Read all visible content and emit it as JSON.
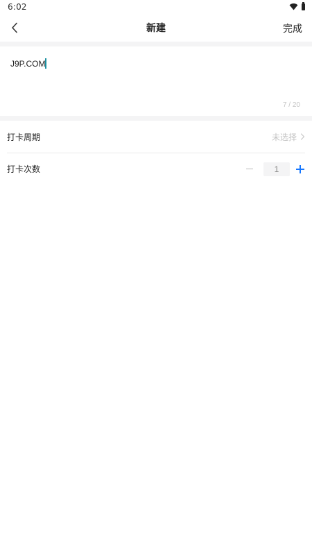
{
  "status_bar": {
    "time": "6:02"
  },
  "header": {
    "title": "新建",
    "done_label": "完成"
  },
  "editor": {
    "value": "J9P.COM",
    "counter": "7 / 20"
  },
  "settings": {
    "period": {
      "label": "打卡周期",
      "value": "未选择"
    },
    "count": {
      "label": "打卡次数",
      "value": "1"
    }
  },
  "colors": {
    "accent": "#1677ff",
    "caret": "#1a8fa0",
    "divider_bg": "#f4f4f5",
    "muted_text": "#c4c4c4"
  },
  "icons": [
    "back-icon",
    "chevron-right-icon",
    "minus-icon",
    "plus-icon",
    "wifi-icon",
    "battery-icon"
  ]
}
